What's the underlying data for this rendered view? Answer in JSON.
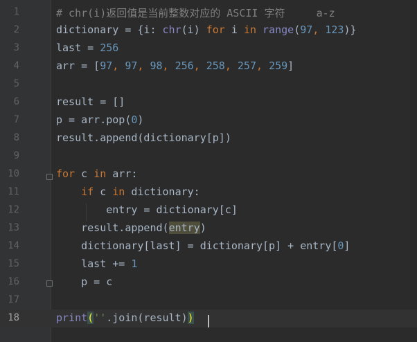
{
  "lines": [
    {
      "n": "1",
      "tokens": [
        {
          "t": "# chr(i)返回值是当前整数对应的 ASCII 字符     a-z",
          "c": "comment"
        }
      ]
    },
    {
      "n": "2",
      "tokens": [
        {
          "t": "dictionary = {i: ",
          "c": "plain"
        },
        {
          "t": "chr",
          "c": "builtin"
        },
        {
          "t": "(i) ",
          "c": "plain"
        },
        {
          "t": "for",
          "c": "kw"
        },
        {
          "t": " i ",
          "c": "plain"
        },
        {
          "t": "in",
          "c": "kw"
        },
        {
          "t": " ",
          "c": "plain"
        },
        {
          "t": "range",
          "c": "builtin"
        },
        {
          "t": "(",
          "c": "plain"
        },
        {
          "t": "97",
          "c": "num"
        },
        {
          "t": ", ",
          "c": "kw"
        },
        {
          "t": "123",
          "c": "num"
        },
        {
          "t": ")}",
          "c": "plain"
        }
      ]
    },
    {
      "n": "3",
      "tokens": [
        {
          "t": "last = ",
          "c": "plain"
        },
        {
          "t": "256",
          "c": "num"
        }
      ]
    },
    {
      "n": "4",
      "tokens": [
        {
          "t": "arr = [",
          "c": "plain"
        },
        {
          "t": "97",
          "c": "num"
        },
        {
          "t": ", ",
          "c": "kw"
        },
        {
          "t": "97",
          "c": "num"
        },
        {
          "t": ", ",
          "c": "kw"
        },
        {
          "t": "98",
          "c": "num"
        },
        {
          "t": ", ",
          "c": "kw"
        },
        {
          "t": "256",
          "c": "num"
        },
        {
          "t": ", ",
          "c": "kw"
        },
        {
          "t": "258",
          "c": "num"
        },
        {
          "t": ", ",
          "c": "kw"
        },
        {
          "t": "257",
          "c": "num"
        },
        {
          "t": ", ",
          "c": "kw"
        },
        {
          "t": "259",
          "c": "num"
        },
        {
          "t": "]",
          "c": "plain"
        }
      ]
    },
    {
      "n": "5",
      "tokens": []
    },
    {
      "n": "6",
      "tokens": [
        {
          "t": "result = []",
          "c": "plain"
        }
      ]
    },
    {
      "n": "7",
      "tokens": [
        {
          "t": "p = arr.pop(",
          "c": "plain"
        },
        {
          "t": "0",
          "c": "num"
        },
        {
          "t": ")",
          "c": "plain"
        }
      ]
    },
    {
      "n": "8",
      "tokens": [
        {
          "t": "result.append(dictionary[p])",
          "c": "plain"
        }
      ]
    },
    {
      "n": "9",
      "tokens": []
    },
    {
      "n": "10",
      "tokens": [
        {
          "t": "for",
          "c": "kw"
        },
        {
          "t": " c ",
          "c": "plain"
        },
        {
          "t": "in",
          "c": "kw"
        },
        {
          "t": " arr:",
          "c": "plain"
        }
      ]
    },
    {
      "n": "11",
      "tokens": [
        {
          "t": "    ",
          "c": "plain"
        },
        {
          "t": "if",
          "c": "kw"
        },
        {
          "t": " c ",
          "c": "plain"
        },
        {
          "t": "in",
          "c": "kw"
        },
        {
          "t": " dictionary:",
          "c": "plain"
        }
      ]
    },
    {
      "n": "12",
      "tokens": [
        {
          "t": "        entry = dictionary[c]",
          "c": "plain"
        }
      ]
    },
    {
      "n": "13",
      "tokens": [
        {
          "t": "    result.append(",
          "c": "plain"
        },
        {
          "t": "entry",
          "c": "hl"
        },
        {
          "t": ")",
          "c": "plain"
        }
      ]
    },
    {
      "n": "14",
      "tokens": [
        {
          "t": "    dictionary[last] = dictionary[p] + entry[",
          "c": "plain"
        },
        {
          "t": "0",
          "c": "num"
        },
        {
          "t": "]",
          "c": "plain"
        }
      ]
    },
    {
      "n": "15",
      "tokens": [
        {
          "t": "    last += ",
          "c": "plain"
        },
        {
          "t": "1",
          "c": "num"
        }
      ]
    },
    {
      "n": "16",
      "tokens": [
        {
          "t": "    p = c",
          "c": "plain"
        }
      ]
    },
    {
      "n": "17",
      "tokens": []
    },
    {
      "n": "18",
      "tokens": [
        {
          "t": "print",
          "c": "builtin"
        },
        {
          "t": "(",
          "c": "brace"
        },
        {
          "t": "''",
          "c": "str"
        },
        {
          "t": ".join(result)",
          "c": "plain"
        },
        {
          "t": ")",
          "c": "brace"
        }
      ]
    }
  ],
  "current_line": "18",
  "colors": {
    "background": "#2b2b2b",
    "gutter": "#313335",
    "keyword": "#cc7832",
    "number": "#6897bb",
    "comment": "#808080",
    "builtin": "#8888c6",
    "string": "#6a8759",
    "text": "#a9b7c6"
  },
  "icons": [
    "fold-open-icon",
    "fold-close-icon"
  ]
}
